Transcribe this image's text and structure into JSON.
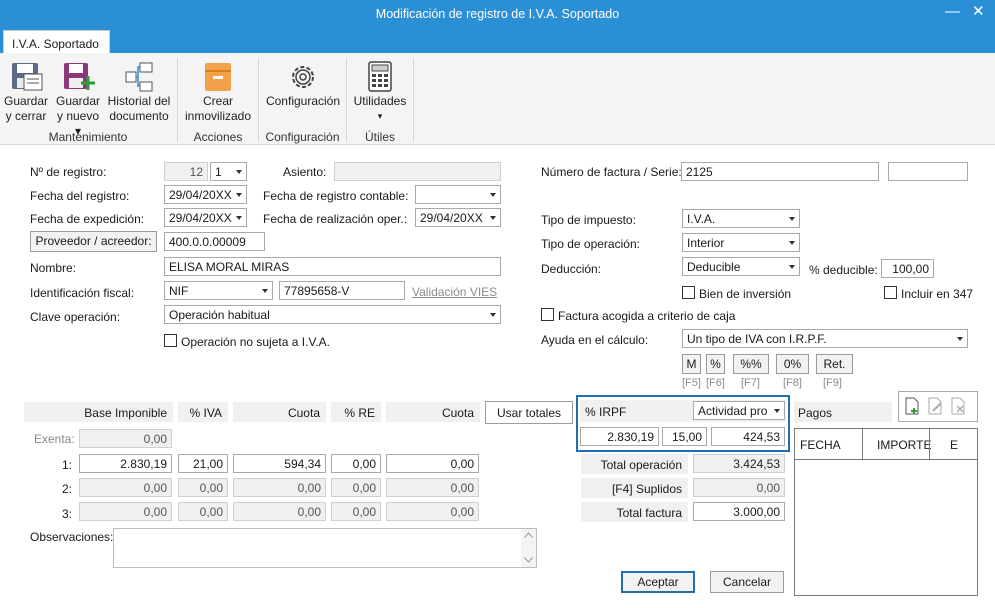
{
  "window": {
    "title": "Modificación de registro de I.V.A. Soportado",
    "minimize": "—",
    "close": "✕"
  },
  "tab": "I.V.A. Soportado",
  "ribbon": {
    "buttons": {
      "guardar_cerrar": [
        "Guardar",
        "y cerrar"
      ],
      "guardar_nuevo": [
        "Guardar",
        "y nuevo ▾"
      ],
      "historial": [
        "Historial del",
        "documento"
      ],
      "crear_inmov": [
        "Crear",
        "inmovilizado"
      ],
      "configuracion": [
        "Configuración",
        ""
      ],
      "utilidades": [
        "Utilidades",
        "▾"
      ]
    },
    "groups": {
      "mantenimiento": "Mantenimiento",
      "acciones": "Acciones",
      "configuracion": "Configuración",
      "utiles": "Útiles"
    }
  },
  "left": {
    "n_registro_label": "Nº de registro:",
    "n_registro": "12",
    "n_registro_serie": "1",
    "asiento_label": "Asiento:",
    "asiento": "",
    "fecha_registro_label": "Fecha del registro:",
    "fecha_registro": "29/04/20XX",
    "fecha_contable_label": "Fecha de registro contable:",
    "fecha_contable": "",
    "fecha_expedicion_label": "Fecha de expedición:",
    "fecha_expedicion": "29/04/20XX",
    "fecha_realizacion_label": "Fecha de realización oper.:",
    "fecha_realizacion": "29/04/20XX",
    "proveedor_button": "Proveedor / acreedor:",
    "proveedor": "400.0.0.00009",
    "nombre_label": "Nombre:",
    "nombre": "ELISA MORAL MIRAS",
    "identificacion_label": "Identificación fiscal:",
    "id_tipo": "NIF",
    "id_valor": "77895658-V",
    "validacion": "Validación VIES",
    "clave_label": "Clave operación:",
    "clave": "Operación habitual",
    "no_sujeta": "Operación no sujeta a I.V.A."
  },
  "right": {
    "factura_label": "Número de factura / Serie:",
    "factura": "2125",
    "serie": "",
    "tipo_impuesto_label": "Tipo de impuesto:",
    "tipo_impuesto": "I.V.A.",
    "tipo_operacion_label": "Tipo de operación:",
    "tipo_operacion": "Interior",
    "deduccion_label": "Deducción:",
    "deduccion": "Deducible",
    "pct_deducible_label": "% deducible:",
    "pct_deducible": "100,00",
    "bien_inversion": "Bien de inversión",
    "incluir_347": "Incluir en 347",
    "criterio_caja": "Factura acogida a criterio de caja",
    "ayuda_label": "Ayuda en el cálculo:",
    "ayuda": "Un tipo de IVA con I.R.P.F.",
    "calc_buttons": [
      "M",
      "%",
      "%%",
      "0%",
      "Ret."
    ],
    "calc_keys": [
      "[F5]",
      "[F6]",
      "[F7]",
      "[F8]",
      "[F9]"
    ]
  },
  "table": {
    "headers": {
      "base": "Base Imponible",
      "iva": "% IVA",
      "cuota": "Cuota",
      "re": "% RE",
      "cuota_re": "Cuota"
    },
    "usar_totales": "Usar totales",
    "exenta_label": "Exenta:",
    "exenta": "0,00",
    "rows": [
      {
        "n": "1:",
        "base": "2.830,19",
        "iva": "21,00",
        "cuota": "594,34",
        "re": "0,00",
        "cuota_re": "0,00"
      },
      {
        "n": "2:",
        "base": "0,00",
        "iva": "0,00",
        "cuota": "0,00",
        "re": "0,00",
        "cuota_re": "0,00"
      },
      {
        "n": "3:",
        "base": "0,00",
        "iva": "0,00",
        "cuota": "0,00",
        "re": "0,00",
        "cuota_re": "0,00"
      }
    ]
  },
  "irpf": {
    "label": "% IRPF",
    "tipo": "Actividad pro",
    "base": "2.830,19",
    "pct": "15,00",
    "cuota": "424,53"
  },
  "totals": {
    "total_op_label": "Total operación",
    "total_op": "3.424,53",
    "suplidos_label": "[F4] Suplidos",
    "suplidos": "0,00",
    "total_factura_label": "Total factura",
    "total_factura": "3.000,00"
  },
  "pagos": {
    "label": "Pagos",
    "cols": [
      "FECHA",
      "IMPORTE",
      "E"
    ]
  },
  "observaciones_label": "Observaciones:",
  "observaciones": "",
  "aceptar": "Aceptar",
  "cancelar": "Cancelar",
  "colors": {
    "titlebar": "#2b8fd6",
    "highlight": "#1f6fb2"
  }
}
